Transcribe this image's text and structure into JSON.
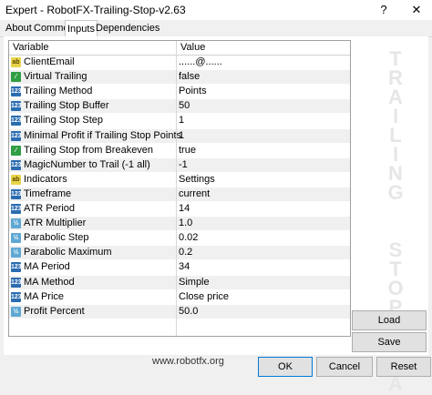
{
  "window": {
    "title": "Expert - RobotFX-Trailing-Stop-v2.63",
    "help": "?",
    "close": "✕"
  },
  "tabs": [
    {
      "label": "About"
    },
    {
      "label": "Common"
    },
    {
      "label": "Inputs"
    },
    {
      "label": "Dependencies"
    }
  ],
  "grid": {
    "columns": {
      "variable": "Variable",
      "value": "Value"
    },
    "rows": [
      {
        "icon": "ab",
        "name": "ClientEmail",
        "value": "......@......"
      },
      {
        "icon": "bool",
        "name": "Virtual Trailing",
        "value": "false"
      },
      {
        "icon": "int",
        "name": "Trailing Method",
        "value": "Points"
      },
      {
        "icon": "int",
        "name": "Trailing Stop Buffer",
        "value": "50"
      },
      {
        "icon": "int",
        "name": "Trailing Stop Step",
        "value": "1"
      },
      {
        "icon": "int",
        "name": "Minimal Profit if Trailing Stop Points",
        "value": "1"
      },
      {
        "icon": "bool",
        "name": "Trailing Stop from Breakeven",
        "value": "true"
      },
      {
        "icon": "int",
        "name": "MagicNumber to Trail (-1 all)",
        "value": "-1"
      },
      {
        "icon": "ab",
        "name": "Indicators",
        "value": "Settings"
      },
      {
        "icon": "int",
        "name": "Timeframe",
        "value": "current"
      },
      {
        "icon": "int",
        "name": "ATR Period",
        "value": "14"
      },
      {
        "icon": "dbl",
        "name": "ATR Multiplier",
        "value": "1.0"
      },
      {
        "icon": "dbl",
        "name": "Parabolic Step",
        "value": "0.02"
      },
      {
        "icon": "dbl",
        "name": "Parabolic Maximum",
        "value": "0.2"
      },
      {
        "icon": "int",
        "name": "MA Period",
        "value": "34"
      },
      {
        "icon": "int",
        "name": "MA Method",
        "value": "Simple"
      },
      {
        "icon": "int",
        "name": "MA Price",
        "value": "Close price"
      },
      {
        "icon": "dbl",
        "name": "Profit Percent",
        "value": "50.0"
      }
    ]
  },
  "footer": {
    "link": "www.robotfx.org"
  },
  "watermark": "TRAILING STOP EA",
  "buttons": {
    "load": "Load",
    "save": "Save",
    "ok": "OK",
    "cancel": "Cancel",
    "reset": "Reset"
  },
  "icons": {
    "ab": "ab",
    "bool": "⁄",
    "int": "123",
    "dbl": "½"
  }
}
